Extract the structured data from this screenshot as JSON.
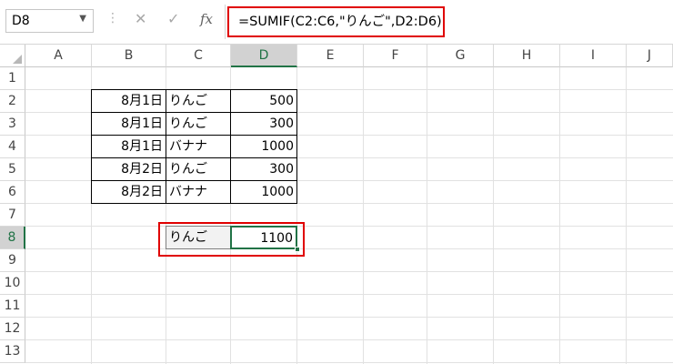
{
  "formula_bar": {
    "name_box": "D8",
    "formula": "=SUMIF(C2:C6,\"りんご\",D2:D6)",
    "icons": [
      "more-options-icon",
      "cancel-icon",
      "enter-icon",
      "insert-function-icon"
    ],
    "fx_label": "fx",
    "highlight_color": "#e00000"
  },
  "grid": {
    "columns": [
      "A",
      "B",
      "C",
      "D",
      "E",
      "F",
      "G",
      "H",
      "I",
      "J"
    ],
    "rows": [
      "1",
      "2",
      "3",
      "4",
      "5",
      "6",
      "7",
      "8",
      "9",
      "10",
      "11",
      "12",
      "13"
    ],
    "active_cell": "D8",
    "accent_color": "#217346"
  },
  "table": [
    {
      "date": "8月1日",
      "item": "りんご",
      "amount": "500"
    },
    {
      "date": "8月1日",
      "item": "りんご",
      "amount": "300"
    },
    {
      "date": "8月1日",
      "item": "バナナ",
      "amount": "1000"
    },
    {
      "date": "8月2日",
      "item": "りんご",
      "amount": "300"
    },
    {
      "date": "8月2日",
      "item": "バナナ",
      "amount": "1000"
    }
  ],
  "result": {
    "label": "りんご",
    "value": "1100"
  }
}
